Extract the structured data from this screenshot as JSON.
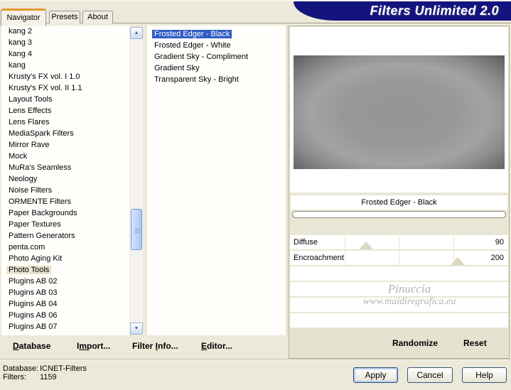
{
  "window": {
    "title": "Filters Unlimited 2.0"
  },
  "tabs": [
    {
      "label": "Navigator",
      "active": true
    },
    {
      "label": "Presets",
      "active": false
    },
    {
      "label": "About",
      "active": false
    }
  ],
  "icons": {
    "scroll_up": "▲",
    "scroll_down": "▼"
  },
  "category_list": {
    "items": [
      {
        "label": "kang 2"
      },
      {
        "label": "kang 3"
      },
      {
        "label": "kang 4"
      },
      {
        "label": "kang"
      },
      {
        "label": "Krusty's FX vol. I 1.0"
      },
      {
        "label": "Krusty's FX vol. II 1.1"
      },
      {
        "label": "Layout Tools"
      },
      {
        "label": "Lens Effects"
      },
      {
        "label": "Lens Flares"
      },
      {
        "label": "MediaSpark Filters"
      },
      {
        "label": "Mirror Rave"
      },
      {
        "label": "Mock"
      },
      {
        "label": "MuRa's Seamless"
      },
      {
        "label": "Neology"
      },
      {
        "label": "Noise Filters"
      },
      {
        "label": "ORMENTE Filters"
      },
      {
        "label": "Paper Backgrounds"
      },
      {
        "label": "Paper Textures"
      },
      {
        "label": "Pattern Generators"
      },
      {
        "label": "penta.com"
      },
      {
        "label": "Photo Aging Kit"
      },
      {
        "label": "Photo Tools",
        "selected": true
      },
      {
        "label": "Plugins AB 02"
      },
      {
        "label": "Plugins AB 03"
      },
      {
        "label": "Plugins AB 04"
      },
      {
        "label": "Plugins AB 06"
      },
      {
        "label": "Plugins AB 07"
      }
    ]
  },
  "filter_list": {
    "items": [
      {
        "label": "Frosted Edger - Black",
        "selected": true
      },
      {
        "label": "Frosted Edger - White"
      },
      {
        "label": "Gradient Sky - Compliment"
      },
      {
        "label": "Gradient Sky"
      },
      {
        "label": "Transparent Sky - Bright"
      }
    ]
  },
  "preview": {
    "filter_name": "Frosted Edger - Black"
  },
  "sliders": [
    {
      "label": "Diffuse",
      "value": "90"
    },
    {
      "label": "Encroachment",
      "value": "200"
    }
  ],
  "watermark": {
    "line1": "Pinuccia",
    "line2": "www.maidiregrafica.eu"
  },
  "panel_actions": {
    "randomize": "Randomize",
    "reset": "Reset"
  },
  "menu_bar": {
    "items": [
      {
        "pre": "",
        "mn": "D",
        "post": "atabase"
      },
      {
        "pre": "I",
        "mn": "m",
        "post": "port..."
      },
      {
        "pre": "Filter ",
        "mn": "I",
        "post": "nfo..."
      },
      {
        "pre": "",
        "mn": "E",
        "post": "ditor..."
      }
    ]
  },
  "status": {
    "database_label": "Database:",
    "database_value": "ICNET-Filters",
    "filters_label": "Filters:",
    "filters_value": "1159"
  },
  "buttons": {
    "apply": "Apply",
    "cancel": "Cancel",
    "help": "Help"
  },
  "colors": {
    "banner": "#14147e",
    "selection_blue": "#2f5bc5",
    "selection_tan": "#e7e3cf",
    "dialog_bg": "#ece9d8",
    "active_tab_accent": "#e5972d"
  }
}
